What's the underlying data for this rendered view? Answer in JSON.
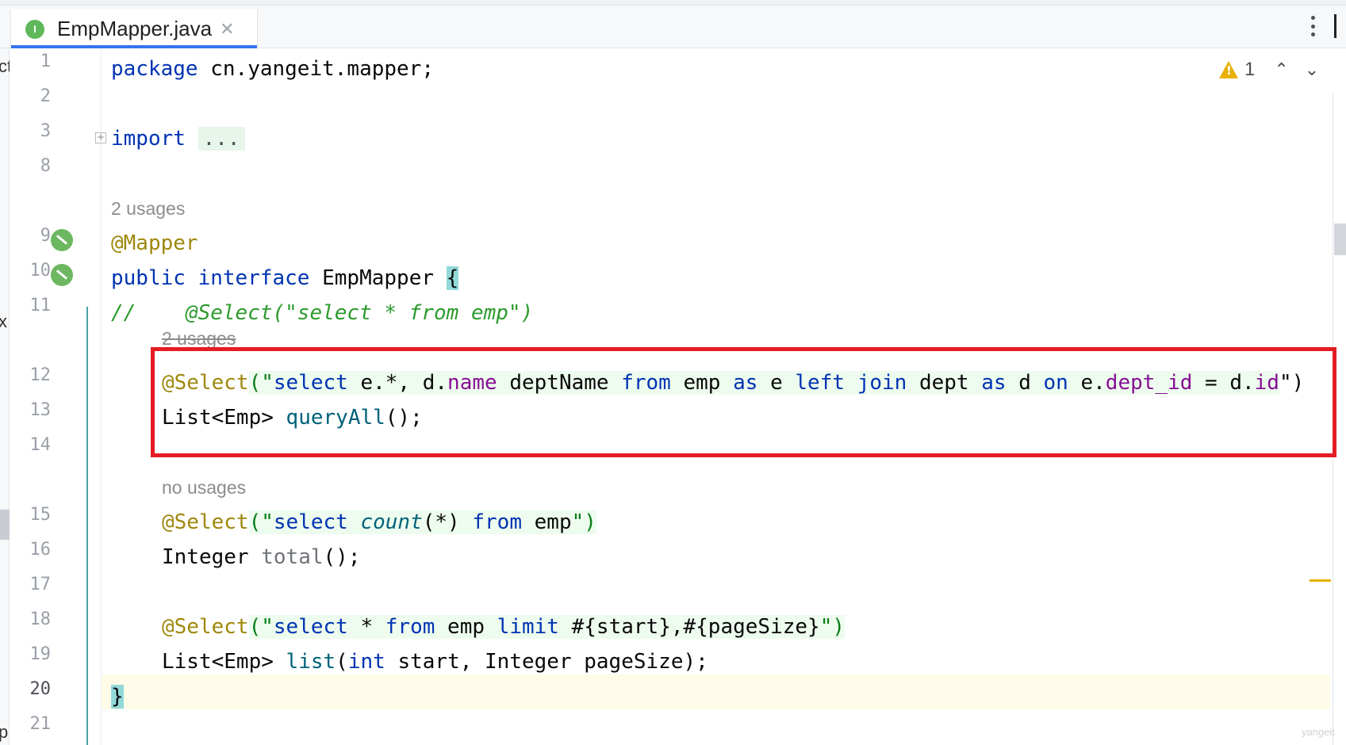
{
  "tab": {
    "title": "EmpMapper.java",
    "icon_letter": "I",
    "icon_name": "interface-icon",
    "close_glyph": "✕"
  },
  "inspections": {
    "warning_count": "1",
    "up_glyph": "⌃",
    "down_glyph": "⌄"
  },
  "left_panel": {
    "fragments": [
      "ct",
      "x",
      "p"
    ]
  },
  "gutter": {
    "line_numbers": [
      "1",
      "2",
      "3",
      "8",
      "9",
      "10",
      "11",
      "12",
      "13",
      "14",
      "15",
      "16",
      "17",
      "18",
      "19",
      "20",
      "21"
    ],
    "current_line": "20"
  },
  "hints": {
    "mapper_usages": "2 usages",
    "queryall_usages": "2 usages",
    "total_usages": "no usages"
  },
  "code": {
    "l1_kw": "package",
    "l1_rest": " cn.yangeit.mapper;",
    "l3_kw": "import",
    "l3_fold": "...",
    "l9_ann": "@Mapper",
    "l10_kw1": "public",
    "l10_kw2": "interface",
    "l10_name": "EmpMapper",
    "l10_brace": "{",
    "l11_comment_slash": "//",
    "l11_comment_rest": "    @Select(\"select * from emp\")",
    "l12_ann": "@Select",
    "l12_open": "(\"",
    "l12_sql": [
      {
        "t": "select",
        "c": "sqlkw"
      },
      {
        "t": " e.*, d.",
        "c": ""
      },
      {
        "t": "name",
        "c": "fld"
      },
      {
        "t": " deptName ",
        "c": ""
      },
      {
        "t": "from",
        "c": "sqlkw"
      },
      {
        "t": " emp ",
        "c": ""
      },
      {
        "t": "as",
        "c": "sqlkw"
      },
      {
        "t": " e ",
        "c": ""
      },
      {
        "t": "left",
        "c": "sqlkw"
      },
      {
        "t": " ",
        "c": ""
      },
      {
        "t": "join",
        "c": "sqlkw"
      },
      {
        "t": " dept ",
        "c": ""
      },
      {
        "t": "as",
        "c": "sqlkw"
      },
      {
        "t": " d ",
        "c": ""
      },
      {
        "t": "on",
        "c": "sqlkw"
      },
      {
        "t": " e.",
        "c": ""
      },
      {
        "t": "dept_id",
        "c": "fld"
      },
      {
        "t": " = d.",
        "c": ""
      },
      {
        "t": "id",
        "c": "fld"
      }
    ],
    "l12_close": "\")",
    "l13_type": "List<Emp>",
    "l13_method": "queryAll",
    "l13_end": "();",
    "l15_ann": "@Select",
    "l15_open": "(\"",
    "l15_sql": [
      {
        "t": "select",
        "c": "sqlkw"
      },
      {
        "t": " ",
        "c": ""
      },
      {
        "t": "count",
        "c": "meth italic"
      },
      {
        "t": "(*) ",
        "c": ""
      },
      {
        "t": "from",
        "c": "sqlkw"
      },
      {
        "t": " emp",
        "c": ""
      }
    ],
    "l15_close": "\")",
    "l16_type": "Integer",
    "l16_method": "total",
    "l16_end": "();",
    "l18_ann": "@Select",
    "l18_open": "(\"",
    "l18_sql": [
      {
        "t": "select",
        "c": "sqlkw"
      },
      {
        "t": " * ",
        "c": ""
      },
      {
        "t": "from",
        "c": "sqlkw"
      },
      {
        "t": " emp ",
        "c": ""
      },
      {
        "t": "limit",
        "c": "sqlkw"
      },
      {
        "t": " #{start},#{pageSize}",
        "c": ""
      }
    ],
    "l18_close": "\")",
    "l19_type": "List<Emp>",
    "l19_method": "list",
    "l19_paren": "(",
    "l19_int": "int",
    "l19_rest": " start, Integer pageSize);",
    "l20_brace": "}"
  },
  "watermark": "yangeit",
  "colors": {
    "keyword": "#0033b3",
    "annotation": "#9e880d",
    "string": "#067d17",
    "field": "#871094",
    "method": "#00627a",
    "comment": "#2d9b2d",
    "highlight_box": "#e51c23",
    "warning": "#e8b100"
  }
}
